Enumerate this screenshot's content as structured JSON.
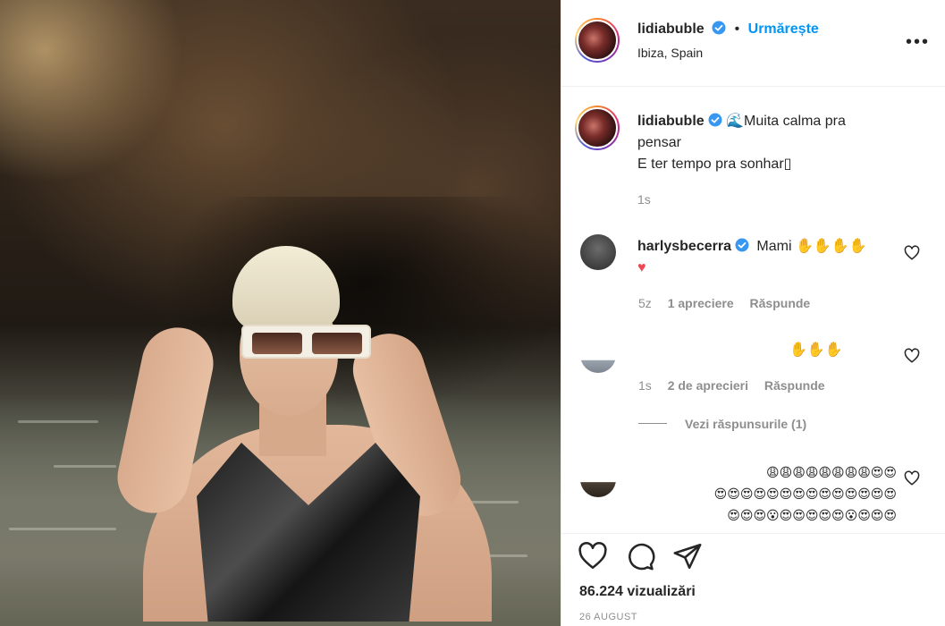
{
  "post": {
    "username": "lidiabuble",
    "follow_label": "Urmărește",
    "location": "Ibiza, Spain",
    "more_icon": "ellipsis-icon"
  },
  "caption": {
    "username": "lidiabuble",
    "line1": "🌊Muita calma pra",
    "line2": "pensar",
    "line3": "E ter tempo pra sonhar▯",
    "time": "1s"
  },
  "comments": [
    {
      "username": "harlysbecerra",
      "text_line1": "Mami ✋✋✋✋",
      "text_line2": "♥",
      "time": "5z",
      "likes": "1 apreciere",
      "reply": "Răspunde"
    },
    {
      "username": "",
      "text_line1": "✋✋✋",
      "time": "1s",
      "likes": "2 de aprecieri",
      "reply": "Răspunde",
      "view_replies": "Vezi răspunsurile (1)"
    },
    {
      "username": "",
      "text_line1": "😩😩😩😩😩😩😩😩😍😍",
      "text_line2": "😍😍😍😍😍😍😍😍😍😍😍😍😍😍",
      "text_line3": "😍😍😍😮😍😍😍😍😍😮😍😍😍"
    }
  ],
  "footer": {
    "views": "86.224 vizualizări",
    "date": "26 AUGUST"
  },
  "colors": {
    "accent": "#0095f6",
    "verified": "#3897f0",
    "heart_red": "#ed4956",
    "muted": "#8e8e8e"
  }
}
